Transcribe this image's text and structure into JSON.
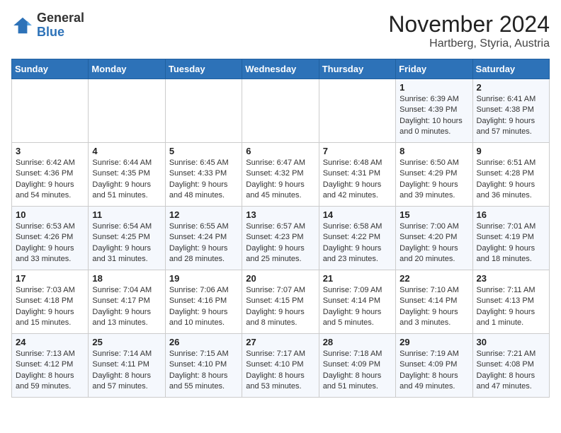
{
  "logo": {
    "general": "General",
    "blue": "Blue"
  },
  "title": "November 2024",
  "location": "Hartberg, Styria, Austria",
  "days_of_week": [
    "Sunday",
    "Monday",
    "Tuesday",
    "Wednesday",
    "Thursday",
    "Friday",
    "Saturday"
  ],
  "weeks": [
    [
      {
        "day": "",
        "detail": ""
      },
      {
        "day": "",
        "detail": ""
      },
      {
        "day": "",
        "detail": ""
      },
      {
        "day": "",
        "detail": ""
      },
      {
        "day": "",
        "detail": ""
      },
      {
        "day": "1",
        "detail": "Sunrise: 6:39 AM\nSunset: 4:39 PM\nDaylight: 10 hours\nand 0 minutes."
      },
      {
        "day": "2",
        "detail": "Sunrise: 6:41 AM\nSunset: 4:38 PM\nDaylight: 9 hours\nand 57 minutes."
      }
    ],
    [
      {
        "day": "3",
        "detail": "Sunrise: 6:42 AM\nSunset: 4:36 PM\nDaylight: 9 hours\nand 54 minutes."
      },
      {
        "day": "4",
        "detail": "Sunrise: 6:44 AM\nSunset: 4:35 PM\nDaylight: 9 hours\nand 51 minutes."
      },
      {
        "day": "5",
        "detail": "Sunrise: 6:45 AM\nSunset: 4:33 PM\nDaylight: 9 hours\nand 48 minutes."
      },
      {
        "day": "6",
        "detail": "Sunrise: 6:47 AM\nSunset: 4:32 PM\nDaylight: 9 hours\nand 45 minutes."
      },
      {
        "day": "7",
        "detail": "Sunrise: 6:48 AM\nSunset: 4:31 PM\nDaylight: 9 hours\nand 42 minutes."
      },
      {
        "day": "8",
        "detail": "Sunrise: 6:50 AM\nSunset: 4:29 PM\nDaylight: 9 hours\nand 39 minutes."
      },
      {
        "day": "9",
        "detail": "Sunrise: 6:51 AM\nSunset: 4:28 PM\nDaylight: 9 hours\nand 36 minutes."
      }
    ],
    [
      {
        "day": "10",
        "detail": "Sunrise: 6:53 AM\nSunset: 4:26 PM\nDaylight: 9 hours\nand 33 minutes."
      },
      {
        "day": "11",
        "detail": "Sunrise: 6:54 AM\nSunset: 4:25 PM\nDaylight: 9 hours\nand 31 minutes."
      },
      {
        "day": "12",
        "detail": "Sunrise: 6:55 AM\nSunset: 4:24 PM\nDaylight: 9 hours\nand 28 minutes."
      },
      {
        "day": "13",
        "detail": "Sunrise: 6:57 AM\nSunset: 4:23 PM\nDaylight: 9 hours\nand 25 minutes."
      },
      {
        "day": "14",
        "detail": "Sunrise: 6:58 AM\nSunset: 4:22 PM\nDaylight: 9 hours\nand 23 minutes."
      },
      {
        "day": "15",
        "detail": "Sunrise: 7:00 AM\nSunset: 4:20 PM\nDaylight: 9 hours\nand 20 minutes."
      },
      {
        "day": "16",
        "detail": "Sunrise: 7:01 AM\nSunset: 4:19 PM\nDaylight: 9 hours\nand 18 minutes."
      }
    ],
    [
      {
        "day": "17",
        "detail": "Sunrise: 7:03 AM\nSunset: 4:18 PM\nDaylight: 9 hours\nand 15 minutes."
      },
      {
        "day": "18",
        "detail": "Sunrise: 7:04 AM\nSunset: 4:17 PM\nDaylight: 9 hours\nand 13 minutes."
      },
      {
        "day": "19",
        "detail": "Sunrise: 7:06 AM\nSunset: 4:16 PM\nDaylight: 9 hours\nand 10 minutes."
      },
      {
        "day": "20",
        "detail": "Sunrise: 7:07 AM\nSunset: 4:15 PM\nDaylight: 9 hours\nand 8 minutes."
      },
      {
        "day": "21",
        "detail": "Sunrise: 7:09 AM\nSunset: 4:14 PM\nDaylight: 9 hours\nand 5 minutes."
      },
      {
        "day": "22",
        "detail": "Sunrise: 7:10 AM\nSunset: 4:14 PM\nDaylight: 9 hours\nand 3 minutes."
      },
      {
        "day": "23",
        "detail": "Sunrise: 7:11 AM\nSunset: 4:13 PM\nDaylight: 9 hours\nand 1 minute."
      }
    ],
    [
      {
        "day": "24",
        "detail": "Sunrise: 7:13 AM\nSunset: 4:12 PM\nDaylight: 8 hours\nand 59 minutes."
      },
      {
        "day": "25",
        "detail": "Sunrise: 7:14 AM\nSunset: 4:11 PM\nDaylight: 8 hours\nand 57 minutes."
      },
      {
        "day": "26",
        "detail": "Sunrise: 7:15 AM\nSunset: 4:10 PM\nDaylight: 8 hours\nand 55 minutes."
      },
      {
        "day": "27",
        "detail": "Sunrise: 7:17 AM\nSunset: 4:10 PM\nDaylight: 8 hours\nand 53 minutes."
      },
      {
        "day": "28",
        "detail": "Sunrise: 7:18 AM\nSunset: 4:09 PM\nDaylight: 8 hours\nand 51 minutes."
      },
      {
        "day": "29",
        "detail": "Sunrise: 7:19 AM\nSunset: 4:09 PM\nDaylight: 8 hours\nand 49 minutes."
      },
      {
        "day": "30",
        "detail": "Sunrise: 7:21 AM\nSunset: 4:08 PM\nDaylight: 8 hours\nand 47 minutes."
      }
    ]
  ]
}
